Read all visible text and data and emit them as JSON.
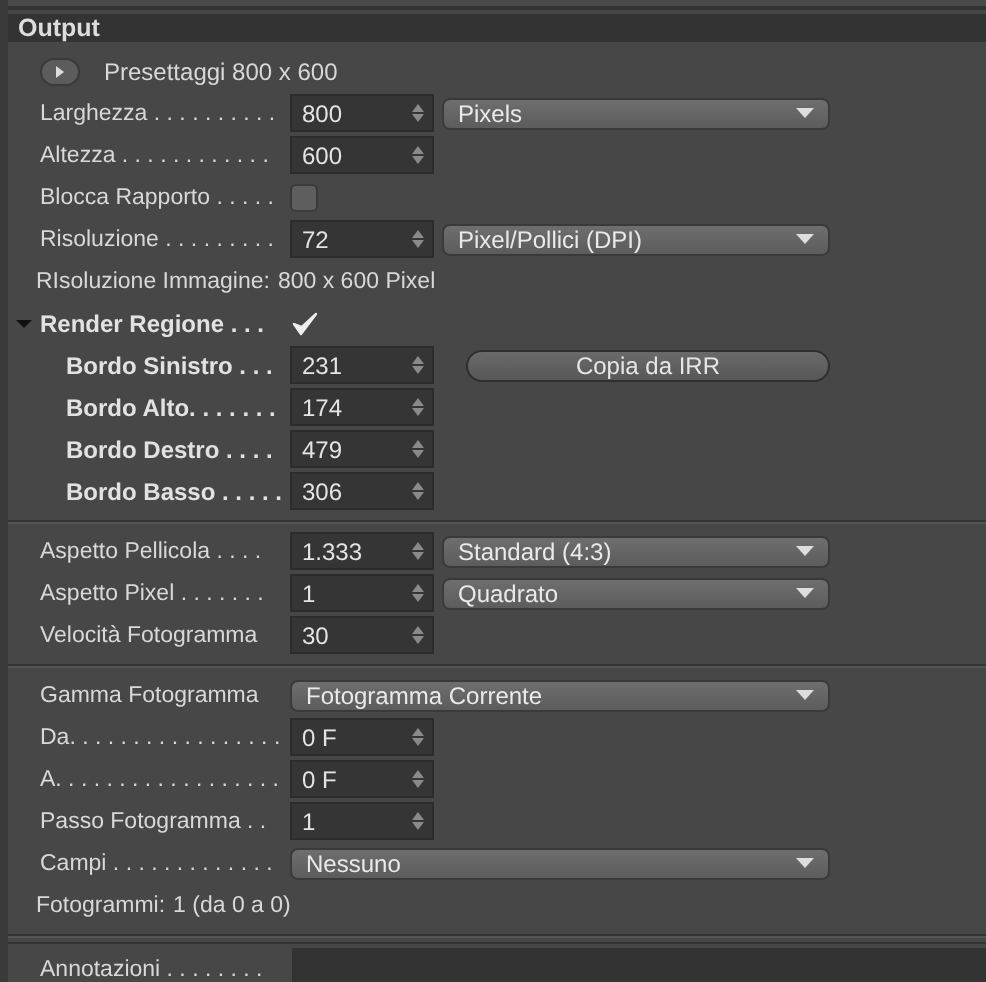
{
  "panel": {
    "title": "Output"
  },
  "sections": [
    {
      "rows": [
        {
          "kind": "preset",
          "label": "Presettaggi 800 x 600"
        },
        {
          "kind": "number",
          "label": "Larghezza . . . . . . . . . .",
          "value": "800",
          "dropdown": "Pixels"
        },
        {
          "kind": "number",
          "label": "Altezza . . . . . . . . . . . .",
          "value": "600"
        },
        {
          "kind": "checkbox",
          "label": "Blocca Rapporto . . . . .",
          "checked": false
        },
        {
          "kind": "number",
          "label": "Risoluzione . . . . . . . . .",
          "value": "72",
          "dropdown": "Pixel/Pollici (DPI)"
        },
        {
          "kind": "info",
          "label": "RIsoluzione Immagine:",
          "value": "800 x 600 Pixel"
        },
        {
          "kind": "group",
          "label": "Render Regione . . .",
          "checked": true,
          "expanded": true,
          "children": [
            {
              "kind": "number",
              "label": "Bordo Sinistro . . .",
              "value": "231",
              "button": "Copia da IRR"
            },
            {
              "kind": "number",
              "label": "Bordo Alto. . . . . . .",
              "value": "174"
            },
            {
              "kind": "number",
              "label": "Bordo Destro . . . .",
              "value": "479"
            },
            {
              "kind": "number",
              "label": "Bordo Basso . . . . .",
              "value": "306"
            }
          ]
        }
      ]
    },
    {
      "rows": [
        {
          "kind": "number",
          "label": "Aspetto Pellicola . . . .",
          "value": "1.333",
          "dropdown": "Standard (4:3)"
        },
        {
          "kind": "number",
          "label": "Aspetto Pixel . . . . . . .",
          "value": "1",
          "dropdown": "Quadrato"
        },
        {
          "kind": "number",
          "label": "Velocità Fotogramma",
          "value": "30"
        }
      ]
    },
    {
      "rows": [
        {
          "kind": "select",
          "label": "Gamma Fotogramma",
          "value": "Fotogramma Corrente"
        },
        {
          "kind": "number",
          "label": "Da. . . . . . . . . . . . . . . . .",
          "value": "0 F"
        },
        {
          "kind": "number",
          "label": "A. . . . . . . . . . . . . . . . . .",
          "value": "0 F"
        },
        {
          "kind": "number",
          "label": "Passo Fotogramma . .",
          "value": "1"
        },
        {
          "kind": "select",
          "label": "Campi . . . . . . . . . . . . .",
          "value": "Nessuno"
        },
        {
          "kind": "info",
          "label": "Fotogrammi:",
          "value": "1 (da 0 a 0)"
        }
      ]
    }
  ],
  "notes": {
    "label": "Annotazioni . . . . . . . ."
  }
}
